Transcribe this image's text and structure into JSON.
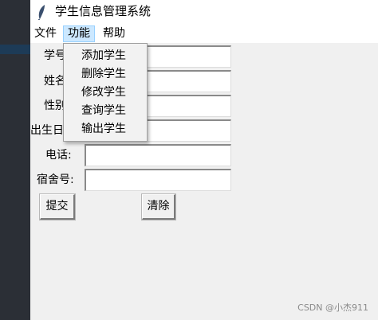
{
  "window": {
    "title": "学生信息管理系统"
  },
  "menubar": {
    "file": "文件",
    "function": "功能",
    "help": "帮助"
  },
  "dropdown": {
    "items": [
      "添加学生",
      "删除学生",
      "修改学生",
      "查询学生",
      "输出学生"
    ]
  },
  "form": {
    "labels": [
      "学号",
      "姓名",
      "性别",
      "出生日",
      "电话:",
      "宿舍号:"
    ]
  },
  "buttons": {
    "submit": "提交",
    "clear": "清除"
  },
  "watermark": "CSDN @小杰911",
  "colors": {
    "menu_highlight": "#cce8ff",
    "window_bg": "#f0f0f0",
    "left_strip": "#2b2f36"
  }
}
